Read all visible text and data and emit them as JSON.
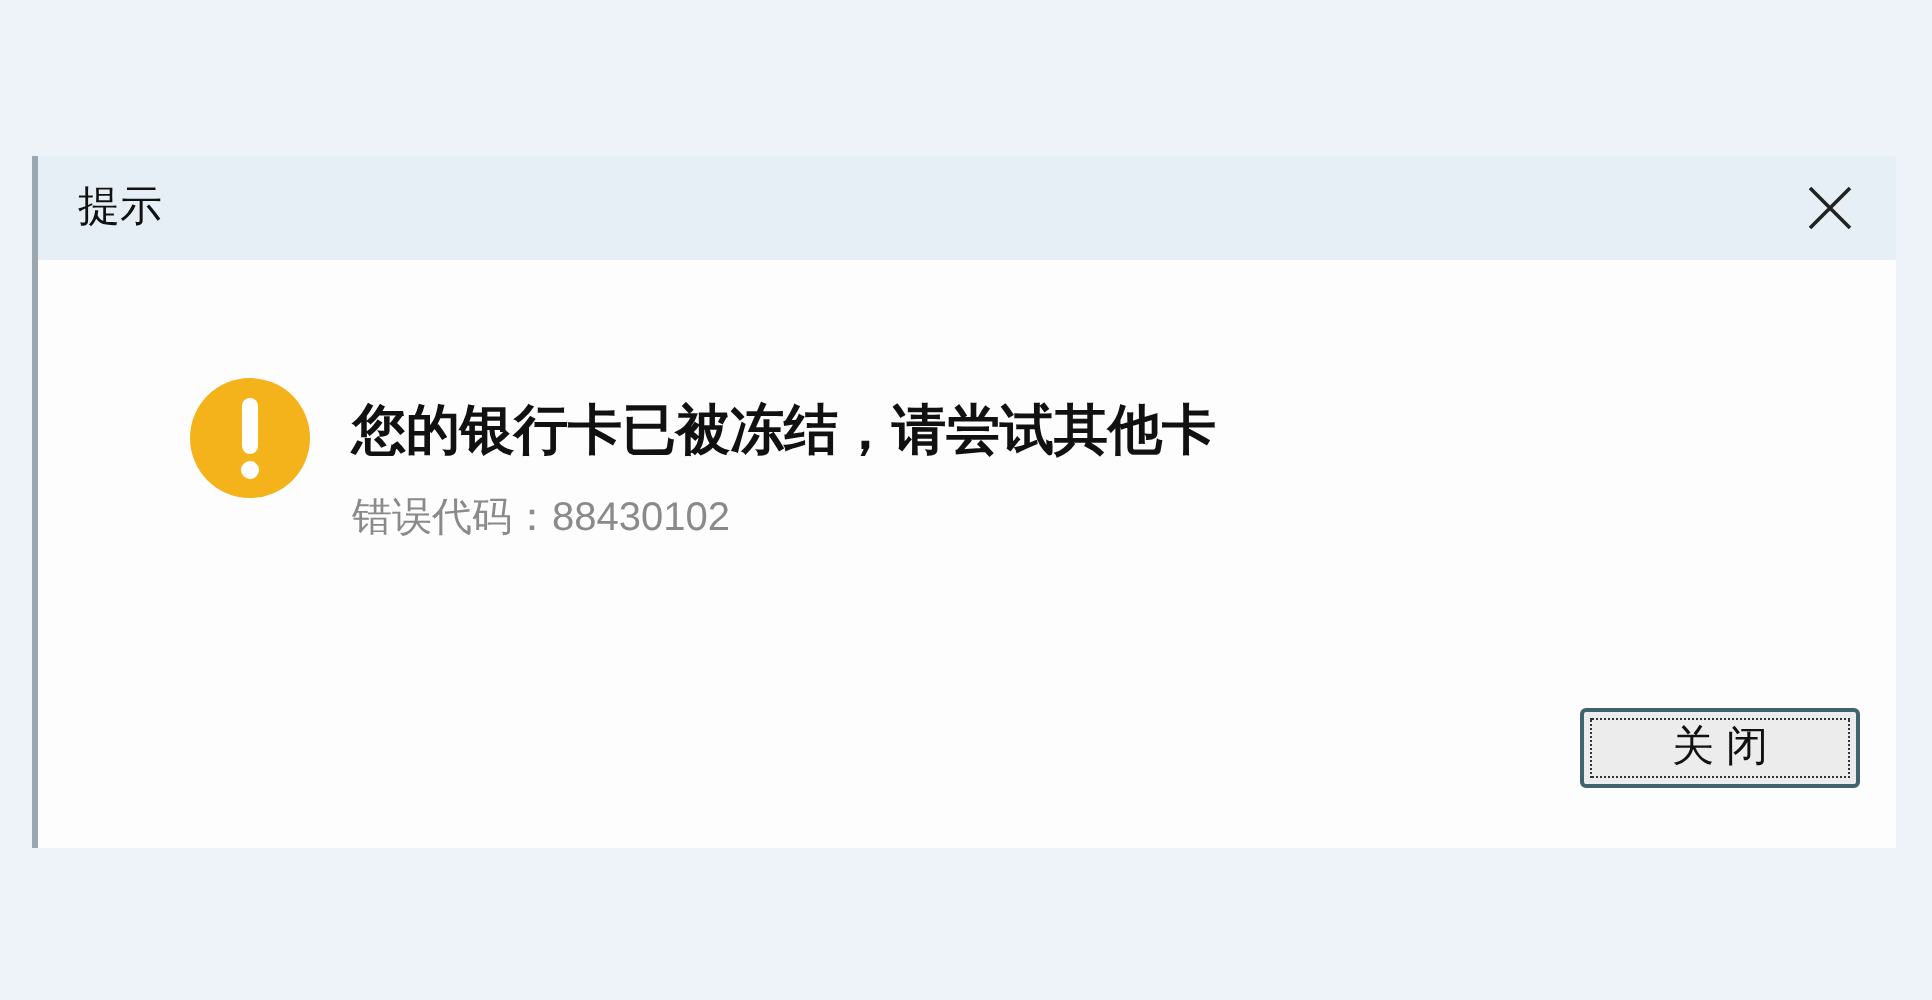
{
  "window": {
    "title": "提示"
  },
  "message": {
    "title": "您的银行卡已被冻结，请尝试其他卡",
    "detail": "错误代码：88430102"
  },
  "buttons": [
    "关 闭"
  ]
}
